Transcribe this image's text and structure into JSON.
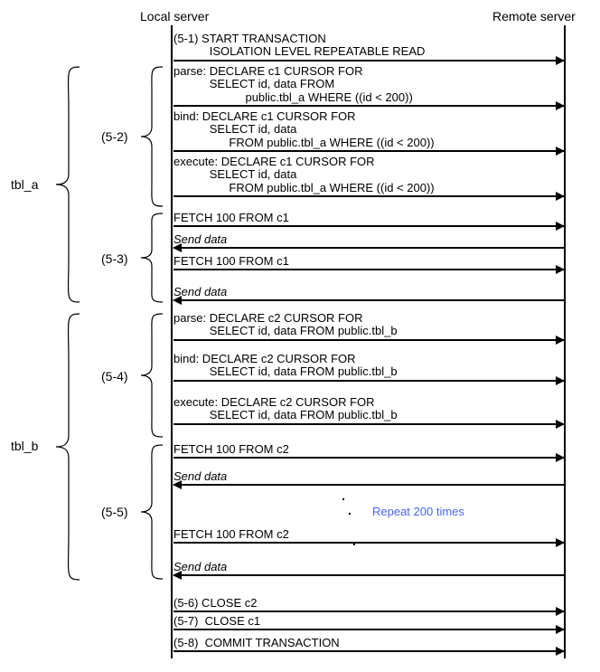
{
  "headers": {
    "local": "Local server",
    "remote": "Remote server"
  },
  "groups": {
    "tbl_a": "tbl_a",
    "tbl_b": "tbl_b"
  },
  "steps": {
    "s52": "(5-2)",
    "s53": "(5-3)",
    "s54": "(5-4)",
    "s55": "(5-5)"
  },
  "messages": {
    "m1": "(5-1) START TRANSACTION\n           ISOLATION LEVEL REPEATABLE READ",
    "m2": "parse: DECLARE c1 CURSOR FOR\n           SELECT id, data FROM\n                      public.tbl_a WHERE ((id < 200))",
    "m3": "bind: DECLARE c1 CURSOR FOR\n           SELECT id, data\n                 FROM public.tbl_a WHERE ((id < 200))",
    "m4": "execute: DECLARE c1 CURSOR FOR\n           SELECT id, data\n                 FROM public.tbl_a WHERE ((id < 200))",
    "m5": "FETCH 100 FROM c1",
    "m6": "Send data",
    "m7": "FETCH 100 FROM c1",
    "m8": "Send data",
    "m9": "parse: DECLARE c2 CURSOR FOR\n           SELECT id, data FROM public.tbl_b",
    "m10": "bind: DECLARE c2 CURSOR FOR\n           SELECT id, data FROM public.tbl_b",
    "m11": "execute: DECLARE c2 CURSOR FOR\n           SELECT id, data FROM public.tbl_b",
    "m12": "FETCH 100 FROM c2",
    "m13": "Send data",
    "m14": "FETCH 100 FROM c2",
    "m15": "Send data",
    "m16": "(5-6) CLOSE c2",
    "m17": "(5-7)  CLOSE c1",
    "m18": "(5-8)  COMMIT TRANSACTION"
  },
  "repeat_label": "Repeat 200 times",
  "chart_data": {
    "type": "sequence-diagram",
    "participants": [
      "Local server",
      "Remote server"
    ],
    "groups": [
      {
        "label": "tbl_a",
        "steps": [
          "(5-2)",
          "(5-3)"
        ]
      },
      {
        "label": "tbl_b",
        "steps": [
          "(5-4)",
          "(5-5)"
        ]
      }
    ],
    "messages": [
      {
        "step": "(5-1)",
        "from": "Local server",
        "to": "Remote server",
        "text": "START TRANSACTION ISOLATION LEVEL REPEATABLE READ"
      },
      {
        "step": "(5-2)",
        "from": "Local server",
        "to": "Remote server",
        "text": "parse: DECLARE c1 CURSOR FOR SELECT id, data FROM public.tbl_a WHERE ((id < 200))"
      },
      {
        "step": "(5-2)",
        "from": "Local server",
        "to": "Remote server",
        "text": "bind: DECLARE c1 CURSOR FOR SELECT id, data FROM public.tbl_a WHERE ((id < 200))"
      },
      {
        "step": "(5-2)",
        "from": "Local server",
        "to": "Remote server",
        "text": "execute: DECLARE c1 CURSOR FOR SELECT id, data FROM public.tbl_a WHERE ((id < 200))"
      },
      {
        "step": "(5-3)",
        "from": "Local server",
        "to": "Remote server",
        "text": "FETCH 100 FROM c1"
      },
      {
        "step": "(5-3)",
        "from": "Remote server",
        "to": "Local server",
        "text": "Send data"
      },
      {
        "step": "(5-3)",
        "from": "Local server",
        "to": "Remote server",
        "text": "FETCH 100 FROM c1"
      },
      {
        "step": "(5-3)",
        "from": "Remote server",
        "to": "Local server",
        "text": "Send data"
      },
      {
        "step": "(5-4)",
        "from": "Local server",
        "to": "Remote server",
        "text": "parse: DECLARE c2 CURSOR FOR SELECT id, data FROM public.tbl_b"
      },
      {
        "step": "(5-4)",
        "from": "Local server",
        "to": "Remote server",
        "text": "bind: DECLARE c2 CURSOR FOR SELECT id, data FROM public.tbl_b"
      },
      {
        "step": "(5-4)",
        "from": "Local server",
        "to": "Remote server",
        "text": "execute: DECLARE c2 CURSOR FOR SELECT id, data FROM public.tbl_b"
      },
      {
        "step": "(5-5)",
        "from": "Local server",
        "to": "Remote server",
        "text": "FETCH 100 FROM c2"
      },
      {
        "step": "(5-5)",
        "from": "Remote server",
        "to": "Local server",
        "text": "Send data"
      },
      {
        "step": "(5-5)",
        "note": "Repeat 200 times"
      },
      {
        "step": "(5-5)",
        "from": "Local server",
        "to": "Remote server",
        "text": "FETCH 100 FROM c2"
      },
      {
        "step": "(5-5)",
        "from": "Remote server",
        "to": "Local server",
        "text": "Send data"
      },
      {
        "step": "(5-6)",
        "from": "Local server",
        "to": "Remote server",
        "text": "CLOSE c2"
      },
      {
        "step": "(5-7)",
        "from": "Local server",
        "to": "Remote server",
        "text": "CLOSE c1"
      },
      {
        "step": "(5-8)",
        "from": "Local server",
        "to": "Remote server",
        "text": "COMMIT TRANSACTION"
      }
    ]
  }
}
